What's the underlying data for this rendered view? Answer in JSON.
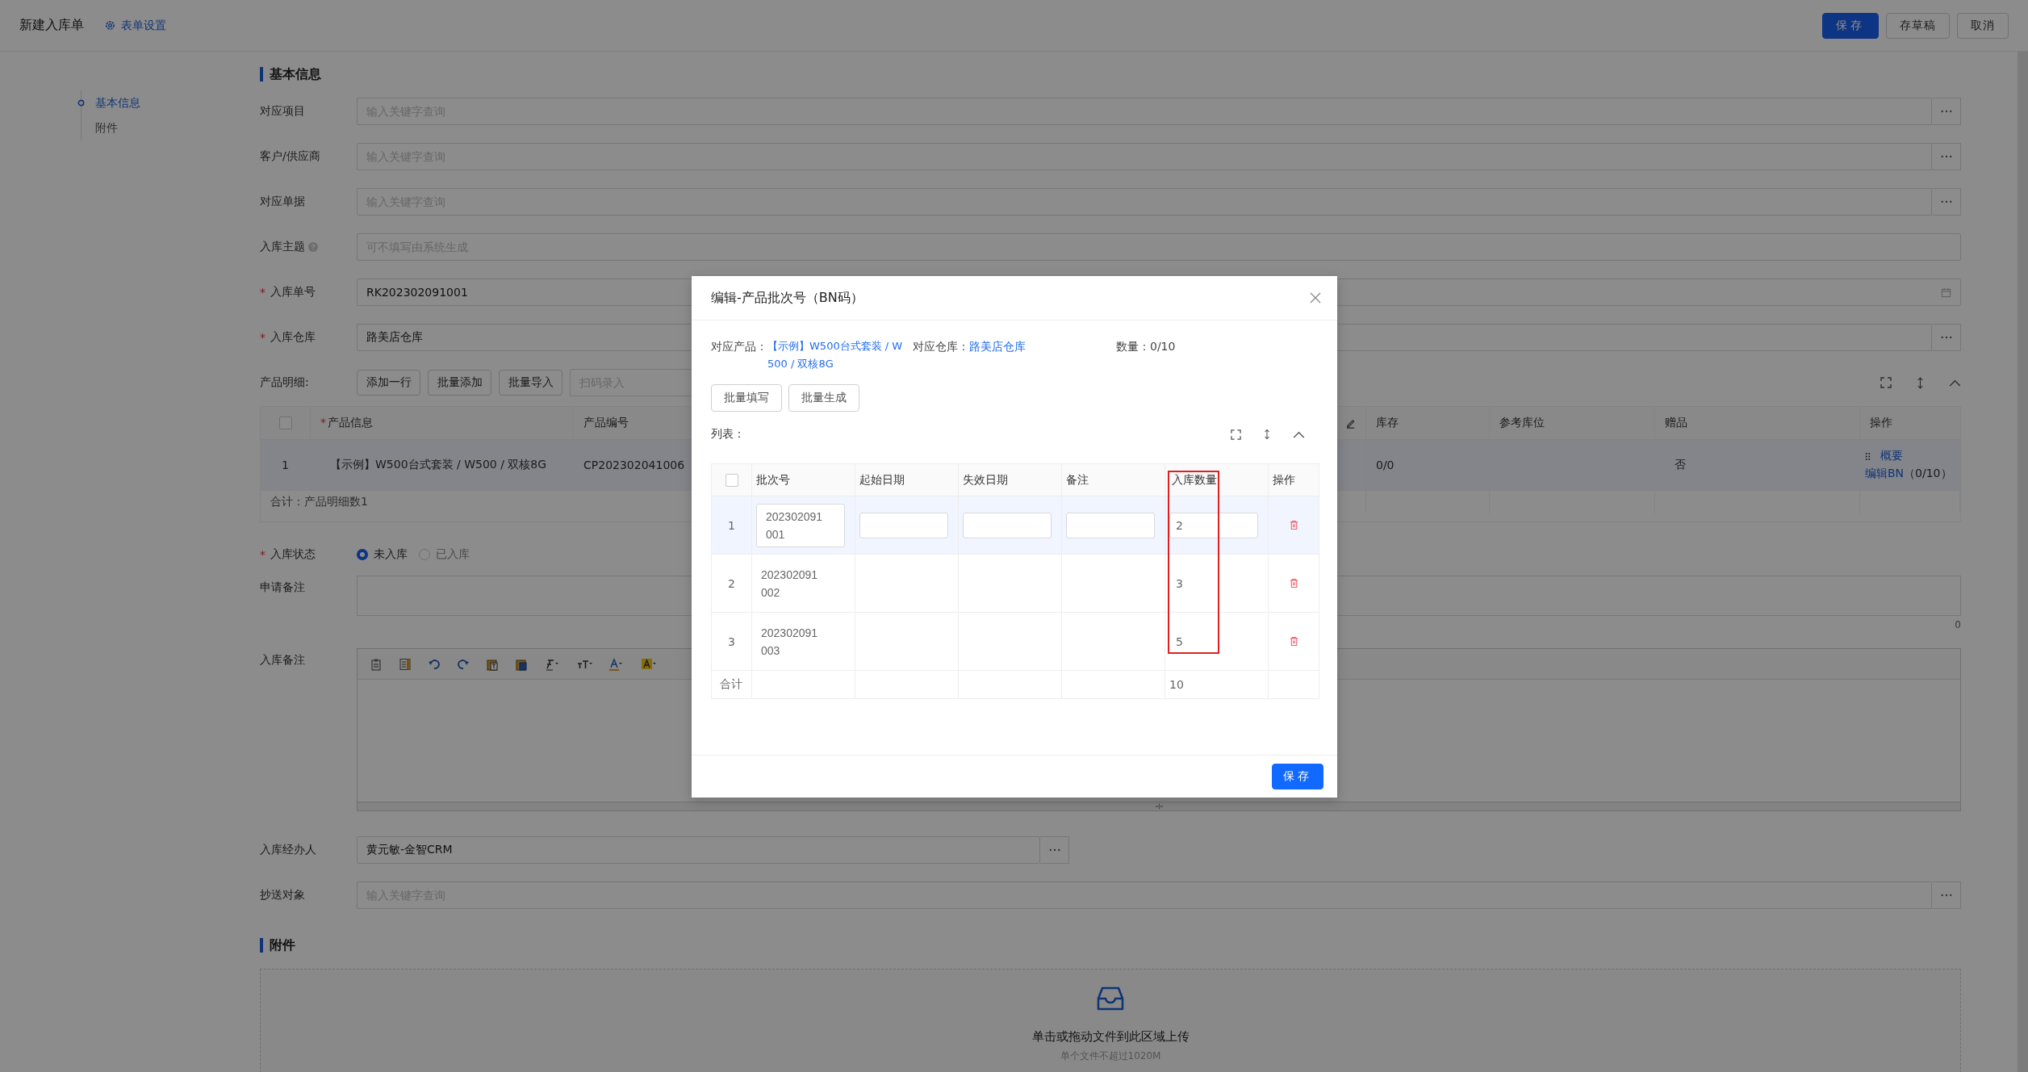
{
  "header": {
    "title": "新建入库单",
    "settings_link": "表单设置",
    "buttons": [
      {
        "label": "保存",
        "kind": "primary"
      },
      {
        "label": "存草稿",
        "kind": "default"
      },
      {
        "label": "取消",
        "kind": "default"
      }
    ]
  },
  "sidebar": {
    "items": [
      {
        "label": "基本信息",
        "selected": true
      },
      {
        "label": "附件",
        "selected": false
      }
    ]
  },
  "basic_section": {
    "title": "基本信息",
    "fields": [
      {
        "label": "对应项目",
        "kind": "lookup",
        "placeholder": "输入关键字查询"
      },
      {
        "label": "客户/供应商",
        "kind": "lookup",
        "placeholder": "输入关键字查询"
      },
      {
        "label": "对应单据",
        "kind": "lookup",
        "placeholder": "输入关键字查询"
      },
      {
        "label": "入库主题",
        "kind": "text",
        "help": true,
        "placeholder": "可不填写由系统生成"
      },
      {
        "label": "入库单号",
        "mark": "*",
        "kind": "date",
        "value": "RK202302091001"
      },
      {
        "label": "入库仓库",
        "mark": "*",
        "kind": "lookup",
        "value": "路美店仓库"
      }
    ]
  },
  "product_detail": {
    "label": "产品明细:",
    "buttons": [
      "添加一行",
      "批量添加",
      "批量导入"
    ],
    "scan": {
      "placeholder": "扫码录入"
    },
    "table": {
      "select_all": {
        "checked": false
      },
      "columns": [
        {
          "label": "产品信息",
          "mark": "*"
        },
        {
          "label": "产品编号"
        },
        {
          "label": "库存"
        },
        {
          "label": "参考库位"
        },
        {
          "label": "赠品"
        },
        {
          "label": "操作"
        }
      ],
      "rows": [
        {
          "index": "1",
          "product": "【示例】W500台式套装 / W500 / 双核8G",
          "code": "CP202302041006",
          "stock": "0/0",
          "gift": "否",
          "links": [
            "概要",
            "编辑BN"
          ],
          "count": "（0/10）",
          "highlighted": true
        }
      ],
      "summary": "合计：产品明细数1"
    }
  },
  "status": {
    "label": "入库状态",
    "mark": "*",
    "options": [
      {
        "label": "未入库",
        "selected": true
      },
      {
        "label": "已入库",
        "selected": false
      }
    ]
  },
  "apply_note": {
    "label": "申请备注",
    "counter": "0"
  },
  "stock_note": {
    "label": "入库备注"
  },
  "handler": {
    "label": "入库经办人",
    "value": "黄元敏-金智CRM"
  },
  "cc": {
    "label": "抄送对象",
    "placeholder": "输入关键字查询"
  },
  "attachments": {
    "title": "附件",
    "upload_text": "单击或拖动文件到此区域上传",
    "hint": "单个文件不超过1020M"
  },
  "modal": {
    "title": "编辑-产品批次号（BN码）",
    "info": [
      {
        "label": "对应产品：",
        "value": "【示例】W500台式套装 / W500 / 双核8G",
        "kind": "link"
      },
      {
        "label": "对应仓库：",
        "value": "路美店仓库",
        "kind": "link"
      },
      {
        "label": "数量：",
        "value": "0/10",
        "kind": "plain"
      }
    ],
    "buttons": [
      "批量填写",
      "批量生成"
    ],
    "list_label": "列表：",
    "table": {
      "select_all": {
        "checked": false
      },
      "columns": [
        {
          "label": "批次号",
          "highlighted": false
        },
        {
          "label": "起始日期",
          "highlighted": false
        },
        {
          "label": "失效日期",
          "highlighted": false
        },
        {
          "label": "备注",
          "highlighted": false
        },
        {
          "label": "入库数量",
          "highlighted": true
        },
        {
          "label": "操作",
          "highlighted": false
        }
      ],
      "rows": [
        {
          "index": "1",
          "batch": "202302091001",
          "quantity": "2",
          "editing": true
        },
        {
          "index": "2",
          "batch": "202302091002",
          "quantity": "3",
          "editing": false
        },
        {
          "index": "3",
          "batch": "202302091003",
          "quantity": "5",
          "editing": false
        }
      ],
      "total": {
        "label": "合计",
        "quantity": "10"
      }
    },
    "save": "保存"
  }
}
